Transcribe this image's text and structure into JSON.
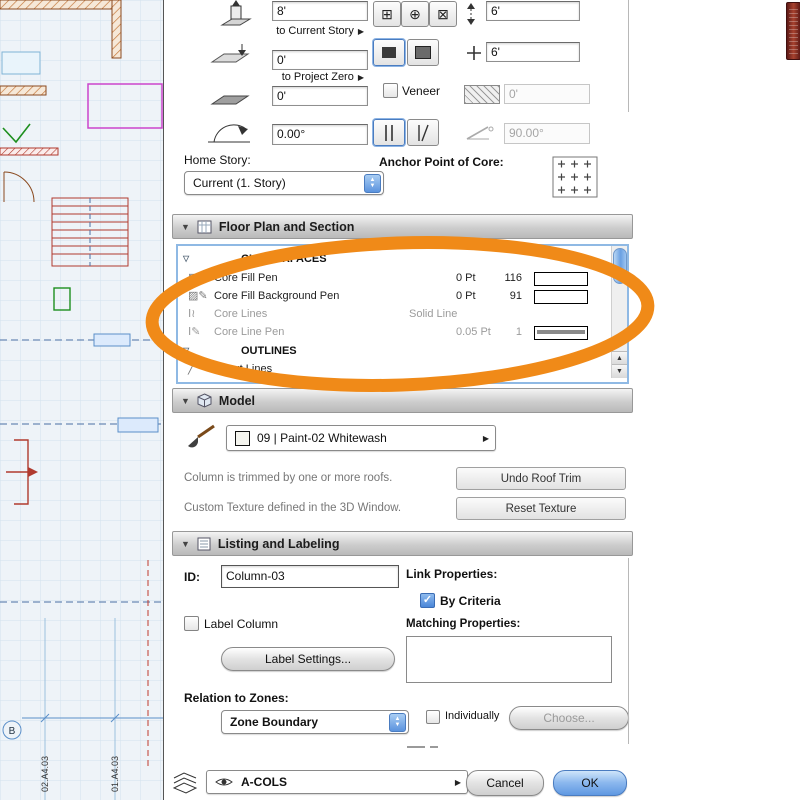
{
  "colors": {
    "accent_orange": "#F08A18",
    "ok_blue": "#5f98e2",
    "focus_ring": "#8fb9e4"
  },
  "geometry_panel": {
    "top_height": "8'",
    "to_current_story": "to Current Story",
    "bottom_offset": "0'",
    "to_project_zero": "to Project Zero",
    "offset_field": "0'",
    "rotation_angle": "0.00°",
    "home_story_label": "Home Story:",
    "home_story_value": "Current (1. Story)",
    "core_width": "6'",
    "core_depth": "6'",
    "veneer_label": "Veneer",
    "veneer_thickness": "0'",
    "slant_angle": "90.00°",
    "anchor_label": "Anchor Point of Core:"
  },
  "floor_plan_section": {
    "title": "Floor Plan and Section",
    "group1": "CUT SURFACES",
    "rows": [
      {
        "name": "Core Fill Pen",
        "value": "0 Pt",
        "pen": "116"
      },
      {
        "name": "Core Fill Background Pen",
        "value": "0 Pt",
        "pen": "91"
      },
      {
        "name": "Core Lines",
        "value": "Solid Line",
        "pen": ""
      },
      {
        "name": "Core Line Pen",
        "value": "0.05 Pt",
        "pen": "1"
      }
    ],
    "group2": "OUTLINES",
    "row_uncut": "Uncut Lines"
  },
  "model_section": {
    "title": "Model",
    "material": "09 | Paint-02 Whitewash",
    "trim_note": "Column is trimmed by one or more roofs.",
    "undo_roof_trim": "Undo Roof Trim",
    "texture_note": "Custom Texture defined in the 3D Window.",
    "reset_texture": "Reset Texture"
  },
  "listing_section": {
    "title": "Listing and Labeling",
    "id_label": "ID:",
    "id_value": "Column-03",
    "label_column": "Label Column",
    "label_settings": "Label Settings...",
    "relation_label": "Relation to Zones:",
    "relation_value": "Zone Boundary",
    "link_properties": "Link Properties:",
    "by_criteria": "By Criteria",
    "matching_properties": "Matching Properties:",
    "individually": "Individually",
    "choose": "Choose..."
  },
  "footer": {
    "layer": "A-COLS",
    "cancel": "Cancel",
    "ok": "OK"
  },
  "plan": {
    "label_b": "B",
    "dim_left": "02.A4.03",
    "dim_right": "01.A4.03"
  }
}
